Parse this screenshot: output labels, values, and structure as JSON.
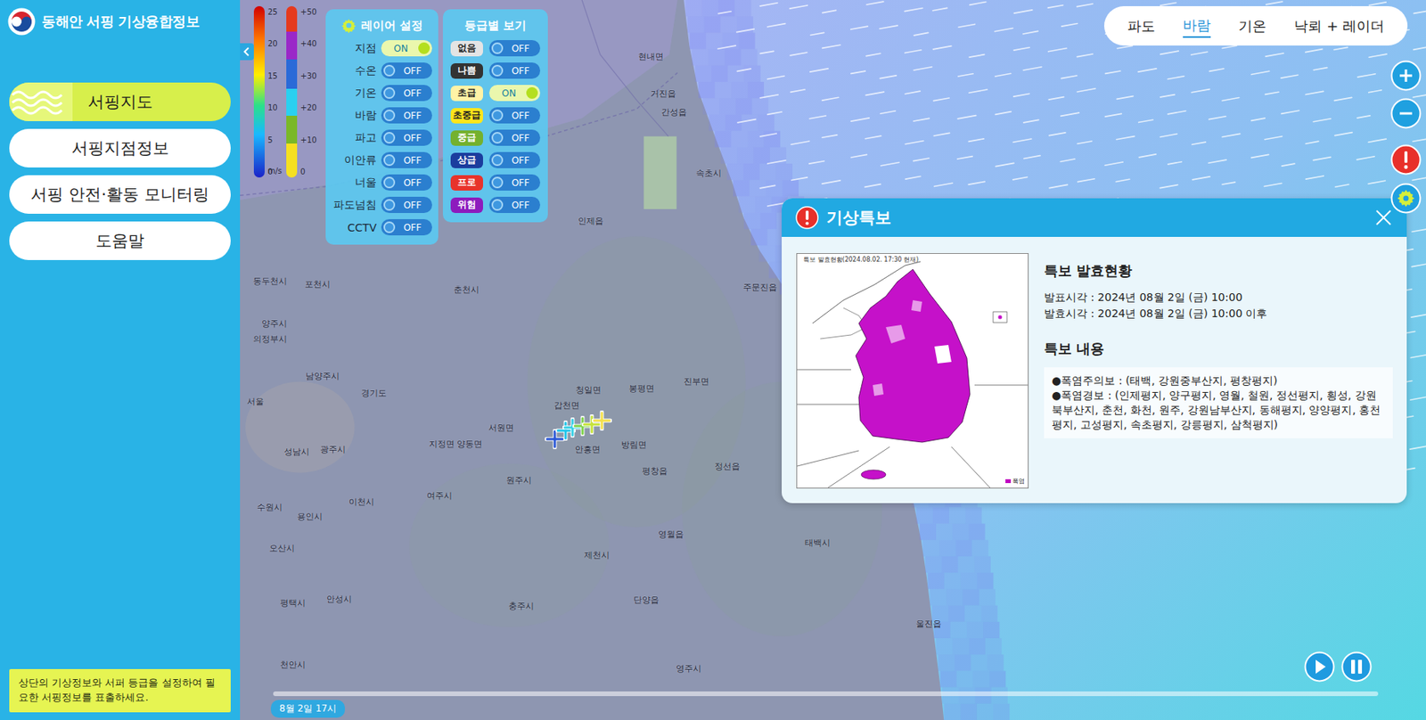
{
  "app": {
    "title": "동해안 서핑 기상융합정보"
  },
  "sidebar": {
    "items": [
      {
        "label": "서핑지도",
        "selected": true
      },
      {
        "label": "서핑지점정보",
        "selected": false
      },
      {
        "label": "서핑 안전·활동 모니터링",
        "selected": false
      },
      {
        "label": "도움말",
        "selected": false
      }
    ],
    "note": "상단의 기상정보와 서퍼 등급을 설정하여 필요한 서핑정보를 표출하세요."
  },
  "legend": {
    "wind_ticks": [
      "25",
      "20",
      "15",
      "10",
      "5",
      "0"
    ],
    "wind_unit": "m/s",
    "second_ticks": [
      "+50",
      "+40",
      "+30",
      "+20",
      "+10",
      "0"
    ]
  },
  "layer_settings": {
    "title": "레이어 설정",
    "layers": [
      {
        "label": "지점",
        "on": true,
        "switch_text": "ON"
      },
      {
        "label": "수온",
        "on": false,
        "switch_text": "OFF"
      },
      {
        "label": "기온",
        "on": false,
        "switch_text": "OFF"
      },
      {
        "label": "바람",
        "on": false,
        "switch_text": "OFF"
      },
      {
        "label": "파고",
        "on": false,
        "switch_text": "OFF"
      },
      {
        "label": "이안류",
        "on": false,
        "switch_text": "OFF"
      },
      {
        "label": "너울",
        "on": false,
        "switch_text": "OFF"
      },
      {
        "label": "파도넘침",
        "on": false,
        "switch_text": "OFF"
      },
      {
        "label": "CCTV",
        "on": false,
        "switch_text": "OFF"
      }
    ]
  },
  "grades": {
    "title": "등급별 보기",
    "items": [
      {
        "label": "없음",
        "on": false,
        "switch_text": "OFF",
        "color": "#e4e4e4"
      },
      {
        "label": "나쁨",
        "on": false,
        "switch_text": "OFF",
        "color": "#333333"
      },
      {
        "label": "초급",
        "on": true,
        "switch_text": "ON",
        "color": "#fff3a6"
      },
      {
        "label": "초중급",
        "on": false,
        "switch_text": "OFF",
        "color": "#ffe51a"
      },
      {
        "label": "중급",
        "on": false,
        "switch_text": "OFF",
        "color": "#74b12e"
      },
      {
        "label": "상급",
        "on": false,
        "switch_text": "OFF",
        "color": "#1b3d9e"
      },
      {
        "label": "프로",
        "on": false,
        "switch_text": "OFF",
        "color": "#e8332b"
      },
      {
        "label": "위험",
        "on": false,
        "switch_text": "OFF",
        "color": "#8d1bbd"
      }
    ]
  },
  "top_tabs": [
    {
      "label": "파도",
      "selected": false
    },
    {
      "label": "바람",
      "selected": true
    },
    {
      "label": "기온",
      "selected": false
    },
    {
      "label": "낙뢰 + 레이더",
      "selected": false
    }
  ],
  "map": {
    "places": [
      {
        "name": "서울"
      },
      {
        "name": "의정부시"
      },
      {
        "name": "동두천시"
      },
      {
        "name": "포천시"
      },
      {
        "name": "양주시"
      },
      {
        "name": "남양주시"
      },
      {
        "name": "성남시"
      },
      {
        "name": "광주시"
      },
      {
        "name": "수원시"
      },
      {
        "name": "용인시"
      },
      {
        "name": "오산시"
      },
      {
        "name": "평택시"
      },
      {
        "name": "안성시"
      },
      {
        "name": "천안시"
      },
      {
        "name": "이천시"
      },
      {
        "name": "여주시"
      },
      {
        "name": "원주시"
      },
      {
        "name": "제천시"
      },
      {
        "name": "충주시"
      },
      {
        "name": "태백시"
      },
      {
        "name": "영주시"
      },
      {
        "name": "속초시"
      },
      {
        "name": "간성읍"
      },
      {
        "name": "거진읍"
      },
      {
        "name": "현내면"
      },
      {
        "name": "인제읍"
      },
      {
        "name": "춘천시"
      },
      {
        "name": "주문진읍"
      },
      {
        "name": "평창읍"
      },
      {
        "name": "정선읍"
      },
      {
        "name": "영월읍"
      },
      {
        "name": "울진읍"
      },
      {
        "name": "단양읍"
      },
      {
        "name": "안흥면"
      },
      {
        "name": "경기도"
      },
      {
        "name": "방림면"
      },
      {
        "name": "진부면"
      },
      {
        "name": "봉평면"
      },
      {
        "name": "청일면"
      },
      {
        "name": "갑천면"
      },
      {
        "name": "서원면"
      },
      {
        "name": "지정면"
      },
      {
        "name": "양동면"
      }
    ],
    "stations": [
      {
        "color": "#2a57d6"
      },
      {
        "color": "#1fc4ea"
      },
      {
        "color": "#36d0e6"
      },
      {
        "color": "#7fd24a"
      },
      {
        "color": "#c6e23a"
      },
      {
        "color": "#f4e04a"
      }
    ]
  },
  "warning": {
    "title": "기상특보",
    "image_caption": "특보 발효현황(2024.08.02. 17:30 현재)",
    "image_legend": "폭염",
    "status_title": "특보 발효현황",
    "announced": "발표시각 : 2024년 08월 2일 (금) 10:00",
    "effective": "발효시각 : 2024년 08월 2일 (금) 10:00 이후",
    "content_title": "특보 내용",
    "lines": [
      "●폭염주의보 : (태백, 강원중부산지, 평창평지)",
      "●폭염경보 : (인제평지, 양구평지, 영월, 철원, 정선평지, 횡성, 강원북부산지, 춘천, 화천, 원주, 강원남부산지, 동해평지, 양양평지, 홍천평지, 고성평지, 속초평지, 강릉평지, 삼척평지)"
    ]
  },
  "timeline": {
    "label": "8월 2일 17시",
    "level": 0
  }
}
